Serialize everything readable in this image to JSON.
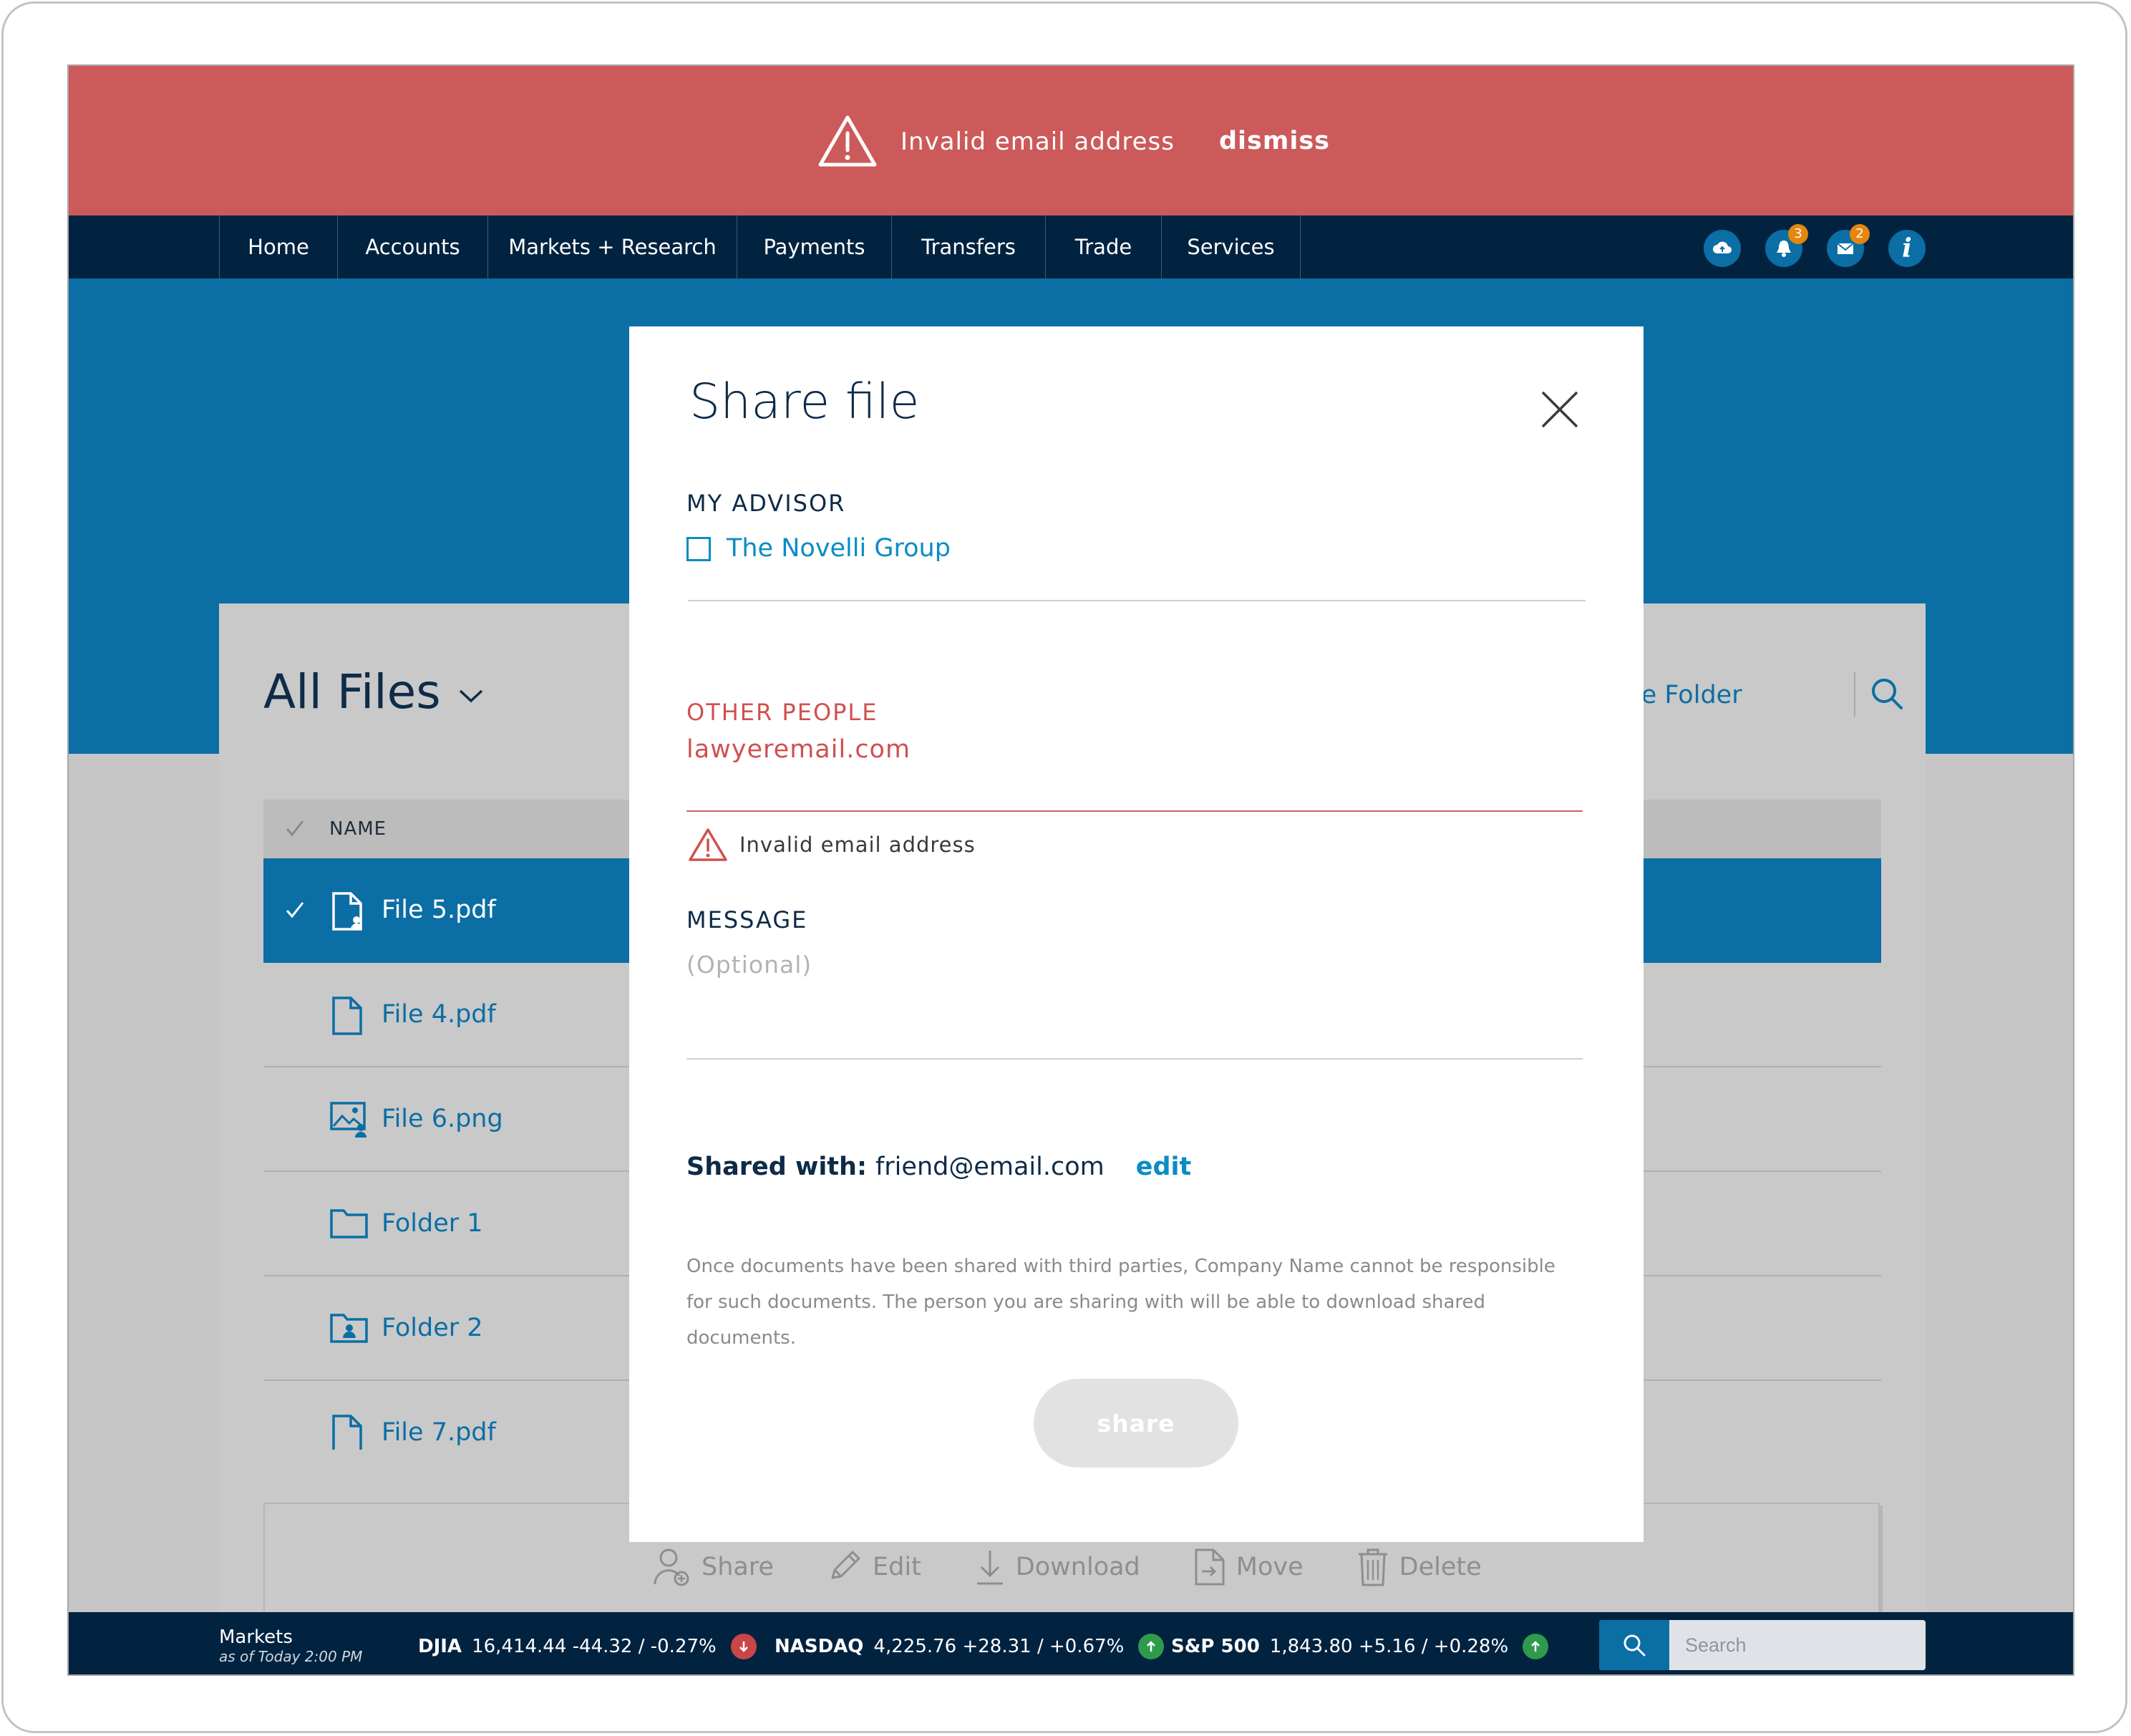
{
  "alert": {
    "message": "Invalid email address",
    "dismiss_label": "dismiss"
  },
  "nav": {
    "items": [
      {
        "label": "Home"
      },
      {
        "label": "Accounts"
      },
      {
        "label": "Markets + Research"
      },
      {
        "label": "Payments"
      },
      {
        "label": "Transfers"
      },
      {
        "label": "Trade"
      },
      {
        "label": "Services"
      }
    ],
    "icons": [
      {
        "name": "cloud-upload-icon",
        "badge": ""
      },
      {
        "name": "bell-icon",
        "badge": "3"
      },
      {
        "name": "mail-icon",
        "badge": "2"
      },
      {
        "name": "info-icon",
        "glyph": "i"
      }
    ],
    "notification_count": "3",
    "message_count": "2",
    "info_glyph": "i"
  },
  "files": {
    "title": "All Files",
    "create_folder_label": "Create Folder",
    "column_name": "NAME",
    "check_glyph": "✓",
    "rows": [
      {
        "name": "File 5.pdf",
        "icon": "shared-file-icon",
        "selected": true
      },
      {
        "name": "File 4.pdf",
        "icon": "file-icon",
        "selected": false
      },
      {
        "name": "File 6.png",
        "icon": "shared-image-icon",
        "selected": false
      },
      {
        "name": "Folder 1",
        "icon": "folder-icon",
        "selected": false
      },
      {
        "name": "Folder 2",
        "icon": "shared-folder-icon",
        "selected": false
      },
      {
        "name": "File 7.pdf",
        "icon": "file-icon",
        "selected": false
      }
    ],
    "actions": [
      {
        "label": "Share",
        "icon": "share-user-icon"
      },
      {
        "label": "Edit",
        "icon": "pencil-icon"
      },
      {
        "label": "Download",
        "icon": "download-icon"
      },
      {
        "label": "Move",
        "icon": "move-file-icon"
      },
      {
        "label": "Delete",
        "icon": "trash-icon"
      }
    ]
  },
  "modal": {
    "title": "Share file",
    "advisor_label": "MY ADVISOR",
    "advisor_name": "The Novelli Group",
    "advisor_checked": false,
    "other_people_label": "OTHER PEOPLE",
    "email_value": "lawyeremail.com",
    "error_message": "Invalid email address",
    "message_label": "MESSAGE",
    "message_placeholder": "(Optional)",
    "shared_with_label": "Shared with:",
    "shared_with_value": "friend@email.com",
    "edit_label": "edit",
    "disclaimer": "Once documents have been shared with third parties, Company Name cannot be responsible for such documents. The person you are sharing with will be able to download shared documents.",
    "share_label": "share",
    "error_color": "#d05050",
    "accent_color": "#0b8cc4"
  },
  "ticker": {
    "title": "Markets",
    "subtitle": "as of Today 2:00 PM",
    "indices": [
      {
        "name": "DJIA",
        "values": "16,414.44  -44.32 / -0.27%",
        "direction": "down",
        "color": "#c94646"
      },
      {
        "name": "NASDAQ",
        "values": "4,225.76  +28.31 / +0.67%",
        "direction": "up",
        "color": "#2f9a4c"
      },
      {
        "name": "S&P 500",
        "values": "1,843.80  +5.16 / +0.28%",
        "direction": "up",
        "color": "#2f9a4c"
      }
    ],
    "search_placeholder": "Search"
  },
  "colors": {
    "alert_bg": "#cc5a5a",
    "nav_bg": "#022340",
    "brand_blue": "#0b6ea5",
    "overlay_gray": "#c6c6c6"
  }
}
